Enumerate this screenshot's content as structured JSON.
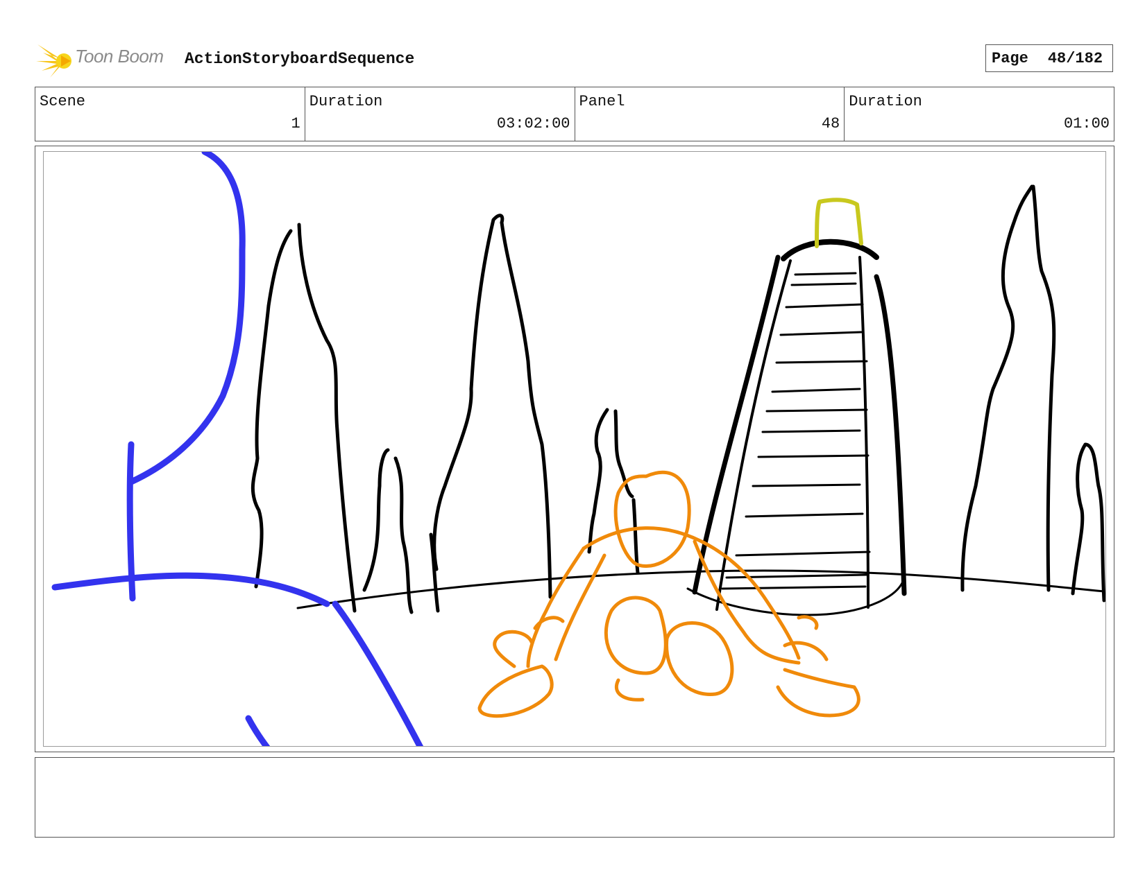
{
  "header": {
    "brand": "Toon Boom",
    "project_title": "ActionStoryboardSequence",
    "page_label": "Page",
    "page_value": "48/182"
  },
  "info": {
    "scene_label": "Scene",
    "scene_value": "1",
    "scene_duration_label": "Duration",
    "scene_duration_value": "03:02:00",
    "panel_label": "Panel",
    "panel_value": "48",
    "panel_duration_label": "Duration",
    "panel_duration_value": "01:00"
  },
  "sketch_colors": {
    "ink": "#000000",
    "foreground_character": "#3333ee",
    "center_character": "#f08a0a",
    "tower_top": "#c8c81e"
  },
  "notes": {
    "text": ""
  }
}
